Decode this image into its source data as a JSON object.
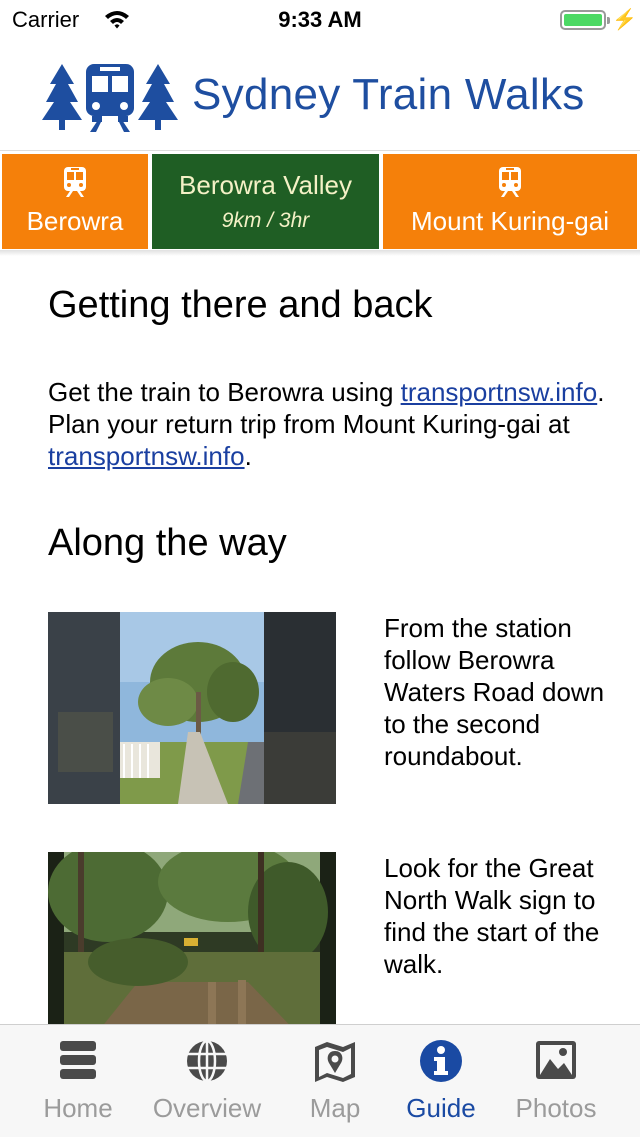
{
  "status_bar": {
    "carrier": "Carrier",
    "time": "9:33 AM"
  },
  "header": {
    "title": "Sydney Train Walks"
  },
  "route": {
    "start_station": "Berowra",
    "walk_name": "Berowra Valley",
    "walk_stats": "9km / 3hr",
    "end_station": "Mount Kuring-gai"
  },
  "guide": {
    "getting_there_heading": "Getting there and back",
    "getting_there_text_1": "Get the train to Berowra using ",
    "link_1": "transportnsw.info",
    "getting_there_text_2": ". Plan your return trip from Mount Kuring-gai at ",
    "link_2": "transportnsw.info",
    "getting_there_text_3": ".",
    "along_heading": "Along the way",
    "steps": [
      {
        "text": "From the station follow Berowra Waters Road down to the second roundabout."
      },
      {
        "text": "Look for the Great North Walk sign to find the start of the walk."
      }
    ]
  },
  "tabs": [
    {
      "label": "Home",
      "icon": "menu-icon"
    },
    {
      "label": "Overview",
      "icon": "globe-icon"
    },
    {
      "label": "Map",
      "icon": "map-icon"
    },
    {
      "label": "Guide",
      "icon": "info-icon",
      "active": true
    },
    {
      "label": "Photos",
      "icon": "photos-icon"
    }
  ],
  "colors": {
    "brand_blue": "#1e4ea0",
    "station_orange": "#f5800a",
    "walk_green": "#1f5e24",
    "tab_active": "#1a4aa3",
    "tab_inactive": "#9b9b9b"
  }
}
